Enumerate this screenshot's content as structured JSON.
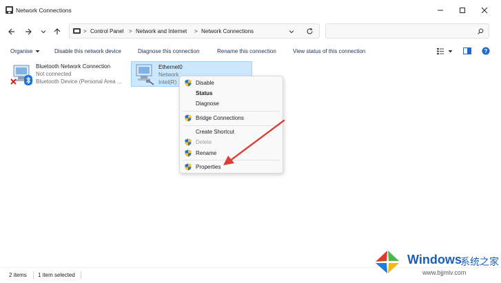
{
  "window": {
    "title": "Network Connections"
  },
  "breadcrumb": {
    "items": [
      "Control Panel",
      "Network and Internet",
      "Network Connections"
    ],
    "separator": ">"
  },
  "search": {
    "placeholder": ""
  },
  "commandbar": {
    "items": [
      "Organise",
      "Disable this network device",
      "Diagnose this connection",
      "Rename this connection",
      "View status of this connection"
    ]
  },
  "connections": [
    {
      "name": "Bluetooth Network Connection",
      "status": "Not connected",
      "device": "Bluetooth Device (Personal Area ..."
    },
    {
      "name": "Ethernet0",
      "status": "Network",
      "device": "Intel(R)"
    }
  ],
  "context_menu": {
    "items": [
      "Disable",
      "Status",
      "Diagnose",
      "Bridge Connections",
      "Create Shortcut",
      "Delete",
      "Rename",
      "Properties"
    ]
  },
  "statusbar": {
    "items_count": "2 items",
    "selection": "1 item selected"
  },
  "watermark": {
    "brand": "Windows",
    "suffix": "系统之家",
    "url": "www.bjjmlv.com"
  },
  "colors": {
    "selection_bg": "#cce8ff",
    "selection_border": "#99d1ff",
    "arrow": "#d9403a",
    "shield_blue": "#2b6cd4",
    "shield_yellow": "#f5c518",
    "watermark_blue": "#1c5fb4"
  },
  "icons": [
    "app-icon",
    "back-icon",
    "forward-icon",
    "recent-icon",
    "up-icon",
    "refresh-icon",
    "search-icon",
    "view-icon",
    "pane-icon",
    "help-icon",
    "network-adapter-icon",
    "bluetooth-icon",
    "disconnected-icon",
    "shield-icon"
  ]
}
